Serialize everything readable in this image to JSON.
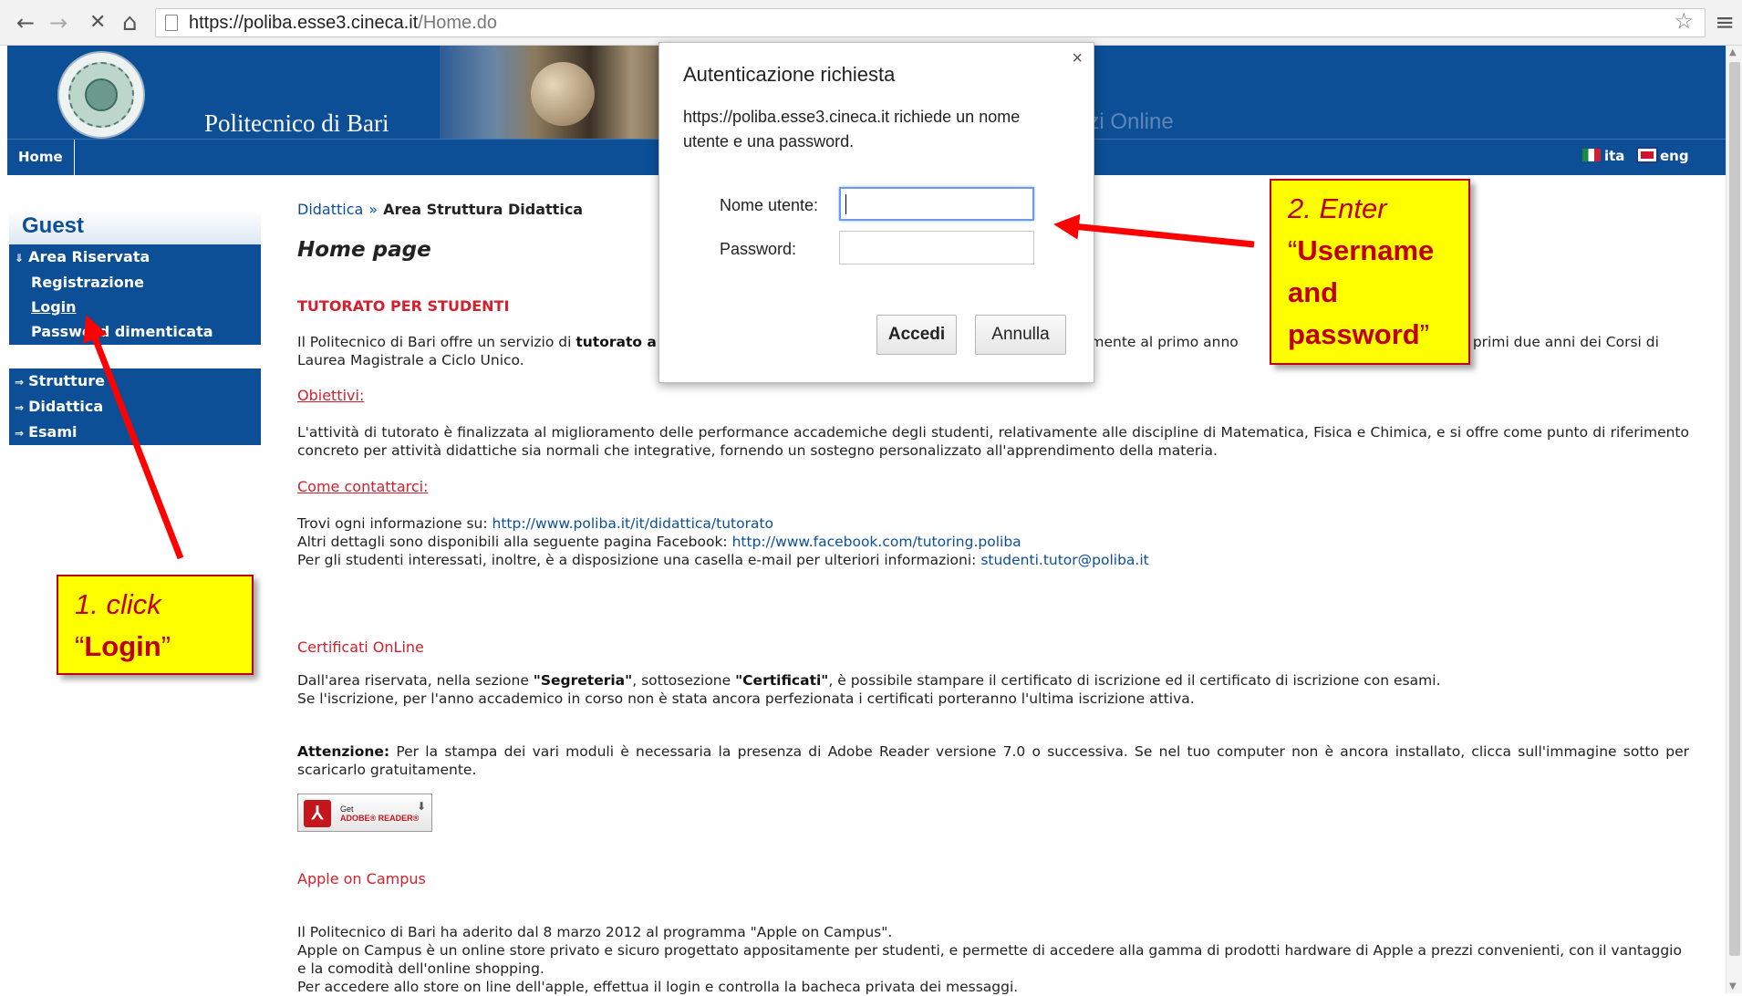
{
  "browser": {
    "url_host": "https://poliba.esse3.cineca.it",
    "url_path": "/Home.do",
    "back": "←",
    "forward": "→",
    "stop": "✕",
    "home": "⌂",
    "star": "☆",
    "menu": "≡"
  },
  "header": {
    "title": "Politecnico di Bari",
    "subtitle": "izi Online"
  },
  "navbar": {
    "home": "Home",
    "lang_it": "ita",
    "lang_en": "eng"
  },
  "sidebar": {
    "guest": "Guest",
    "area_riservata": "Area Riservata",
    "registrazione": "Registrazione",
    "login": "Login",
    "password_dimenticata": "Password dimenticata",
    "strutture": "Strutture",
    "didattica": "Didattica",
    "esami": "Esami"
  },
  "breadcrumb": {
    "link": "Didattica",
    "separator": "»",
    "current": "Area Struttura Didattica"
  },
  "main": {
    "title": "Home page",
    "tutorato_heading": "TUTORATO PER STUDENTI",
    "tutorato_p1a": "Il Politecnico di Bari offre un servizio di",
    "tutorato_p1b": "tutorato a",
    "tutorato_p1c": "temente al primo anno",
    "tutorato_p1d": "e ai primi due anni dei Corsi di",
    "tutorato_p1e": "Laurea Magistrale a Ciclo Unico.",
    "obiettivi": "Obiettivi:",
    "obiettivi_text": "L'attività di tutorato è finalizzata al miglioramento delle performance accademiche degli studenti, relativamente alle discipline di Matematica, Fisica e Chimica, e si offre come punto di riferimento concreto per attività didattiche sia normali che integrative, fornendo un sostegno personalizzato all'apprendimento della materia.",
    "contatti": "Come contattarci:",
    "contatti_l1": "Trovi ogni informazione su:",
    "contatti_link1": "http://www.poliba.it/it/didattica/tutorato",
    "contatti_l2": "Altri dettagli sono disponibili alla seguente pagina Facebook:",
    "contatti_link2": "http://www.facebook.com/tutoring.poliba",
    "contatti_l3": "Per gli studenti interessati, inoltre, è a disposizione una casella e-mail per ulteriori informazioni:",
    "contatti_email": "studenti.tutor@poliba.it",
    "certificati_heading": "Certificati OnLine",
    "cert_l1a": "Dall'area riservata, nella sezione",
    "cert_l1b": "\"Segreteria\"",
    "cert_l1c": ", sottosezione",
    "cert_l1d": "\"Certificati\"",
    "cert_l1e": ", è possibile stampare il certificato di iscrizione ed il certificato di iscrizione con esami.",
    "cert_l2": "Se l'iscrizione, per l'anno accademico in corso non è stata ancora perfezionata i certificati porteranno l'ultima iscrizione attiva.",
    "attenzione_label": "Attenzione:",
    "attenzione_text": "Per la stampa dei vari moduli è necessaria la presenza di Adobe Reader versione 7.0 o successiva. Se nel tuo computer non è ancora installato, clicca sull'immagine sotto per scaricarlo gratuitamente.",
    "adobe_get": "Get",
    "adobe_brand": "ADOBE® READER®",
    "apple_heading": "Apple on Campus",
    "apple_l1": "Il Politecnico di Bari ha aderito dal 8 marzo 2012 al programma \"Apple on Campus\".",
    "apple_l2": "Apple on Campus è un online store privato e sicuro progettato appositamente per studenti, e permette di accedere alla gamma di prodotti hardware di Apple a prezzi convenienti, con il vantaggio e la comodità dell'online shopping.",
    "apple_l3": "Per accedere allo store on line dell'apple, effettua il login e controlla la bacheca privata dei messaggi."
  },
  "dialog": {
    "close": "×",
    "title": "Autenticazione richiesta",
    "message": "https://poliba.esse3.cineca.it richiede un nome utente e una password.",
    "username_label": "Nome utente:",
    "password_label": "Password:",
    "username_value": "",
    "password_value": "",
    "ok": "Accedi",
    "cancel": "Annulla"
  },
  "annotations": {
    "step1_line1": "1. click",
    "step1_word": "Login",
    "step2_line1": "2. Enter",
    "step2_word1": "Username",
    "step2_word2": "and",
    "step2_word3": "password",
    "quote_open": "“",
    "quote_close": "”"
  },
  "colors": {
    "brand_blue": "#0d4f97",
    "heading_red": "#d2202d",
    "callout_yellow": "#ffff00",
    "arrow_red": "#ff0000"
  }
}
